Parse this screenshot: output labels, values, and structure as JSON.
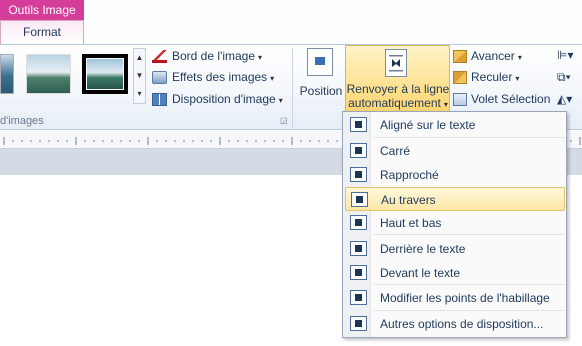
{
  "contextual_tab": {
    "title": "Outils Image"
  },
  "tabs": {
    "active": "Format"
  },
  "picture_styles": {
    "border": "Bord de l'image",
    "effects": "Effets des images",
    "layout": "Disposition d'image",
    "group_label": "d'images"
  },
  "arrange": {
    "position": "Position",
    "wrap_line1": "Renvoyer à la ligne",
    "wrap_line2": "automatiquement",
    "bring_forward": "Avancer",
    "send_backward": "Reculer",
    "selection_pane": "Volet Sélection"
  },
  "wrap_menu": {
    "items": [
      {
        "label": "Aligné sur le texte",
        "icon": "inline-text-icon"
      },
      {
        "label": "Carré",
        "icon": "square-wrap-icon"
      },
      {
        "label": "Rapproché",
        "icon": "tight-wrap-icon"
      },
      {
        "label": "Au travers",
        "icon": "through-wrap-icon",
        "highlighted": true
      },
      {
        "label": "Haut et bas",
        "icon": "top-bottom-wrap-icon"
      },
      {
        "label": "Derrière le texte",
        "icon": "behind-text-icon"
      },
      {
        "label": "Devant le texte",
        "icon": "in-front-text-icon"
      },
      {
        "label": "Modifier les points de l'habillage",
        "icon": "edit-wrap-points-icon"
      },
      {
        "label": "Autres options de disposition...",
        "icon": "more-layout-options-icon"
      }
    ]
  },
  "colors": {
    "contextual_accent": "#d43d9a",
    "highlight": "#ffe8a6"
  }
}
